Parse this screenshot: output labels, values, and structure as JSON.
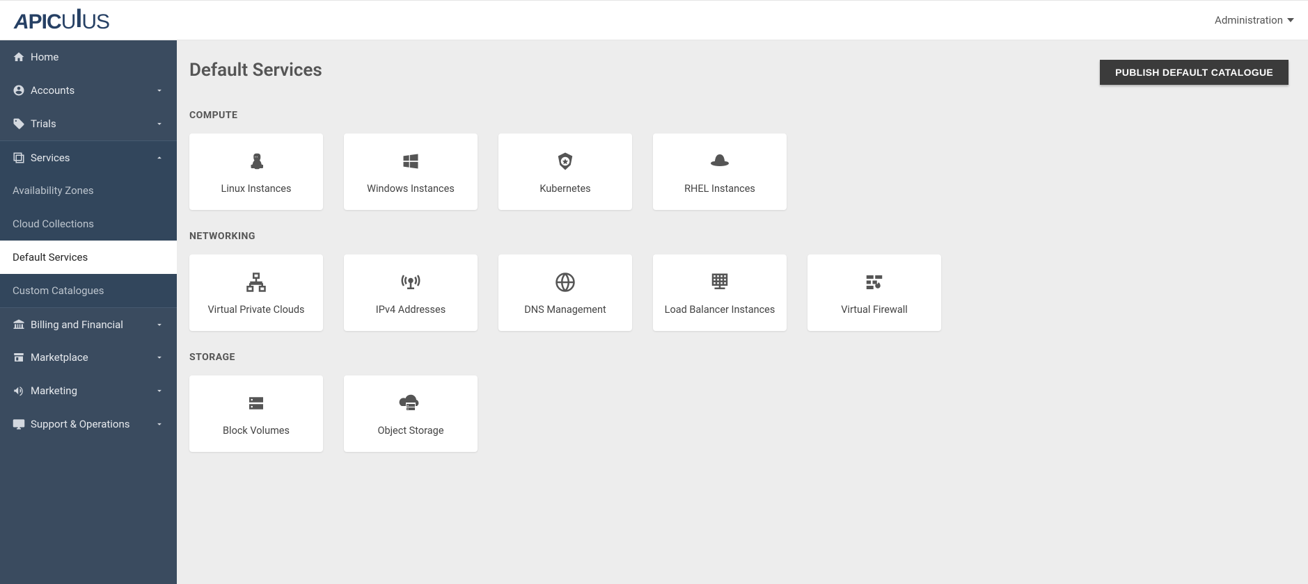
{
  "app": {
    "brand": "APICULUS",
    "admin_menu_label": "Administration"
  },
  "sidebar": {
    "items": [
      {
        "id": "home",
        "label": "Home",
        "has_chev": false
      },
      {
        "id": "accounts",
        "label": "Accounts",
        "has_chev": true
      },
      {
        "id": "trials",
        "label": "Trials",
        "has_chev": true
      },
      {
        "id": "services",
        "label": "Services",
        "has_chev": true,
        "expanded": true,
        "subs": [
          {
            "id": "az",
            "label": "Availability Zones",
            "active": false
          },
          {
            "id": "cc",
            "label": "Cloud Collections",
            "active": false
          },
          {
            "id": "ds",
            "label": "Default Services",
            "active": true
          },
          {
            "id": "cust",
            "label": "Custom Catalogues",
            "active": false
          }
        ]
      },
      {
        "id": "billing",
        "label": "Billing and Financial",
        "has_chev": true
      },
      {
        "id": "marketplace",
        "label": "Marketplace",
        "has_chev": true
      },
      {
        "id": "marketing",
        "label": "Marketing",
        "has_chev": true
      },
      {
        "id": "support",
        "label": "Support & Operations",
        "has_chev": true
      }
    ]
  },
  "page": {
    "title": "Default Services",
    "publish_label": "PUBLISH DEFAULT CATALOGUE"
  },
  "sections": [
    {
      "title": "COMPUTE",
      "cards": [
        {
          "icon": "linux",
          "label": "Linux Instances"
        },
        {
          "icon": "windows",
          "label": "Windows Instances"
        },
        {
          "icon": "kubernetes",
          "label": "Kubernetes"
        },
        {
          "icon": "rhel",
          "label": "RHEL Instances"
        }
      ]
    },
    {
      "title": "NETWORKING",
      "cards": [
        {
          "icon": "vpc",
          "label": "Virtual Private Clouds"
        },
        {
          "icon": "ipv4",
          "label": "IPv4 Addresses"
        },
        {
          "icon": "dns",
          "label": "DNS Management"
        },
        {
          "icon": "loadbalancer",
          "label": "Load Balancer Instances"
        },
        {
          "icon": "firewall",
          "label": "Virtual Firewall"
        }
      ]
    },
    {
      "title": "STORAGE",
      "cards": [
        {
          "icon": "block",
          "label": "Block Volumes"
        },
        {
          "icon": "object",
          "label": "Object Storage"
        }
      ]
    }
  ]
}
